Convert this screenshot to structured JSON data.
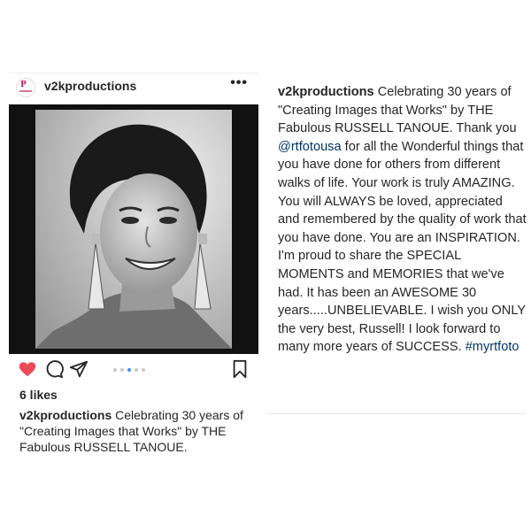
{
  "post": {
    "username": "v2kproductions",
    "avatar_letters": "P",
    "more_label": "•••",
    "likes": "6 likes",
    "caption_username": "v2kproductions",
    "caption_text": " Celebrating 30 years of \"Creating Images that Works\" by THE Fabulous RUSSELL TANOUE.",
    "carousel": {
      "count": 5,
      "active": 2
    },
    "colors": {
      "heart": "#ed4956",
      "dot_active": "#3897f0",
      "text": "#262626"
    }
  },
  "full_caption": {
    "username": "v2kproductions",
    "part1": " Celebrating 30 years of \"Creating Images that Works\" by THE Fabulous RUSSELL TANOUE. Thank you ",
    "mention": "@rtfotousa",
    "part2": " for all the Wonderful things that you have done for others from different walks of life. Your work is truly AMAZING. You will ALWAYS be loved, appreciated and remembered by the quality of work that you have done. You are an INSPIRATION.  I'm proud to share the SPECIAL MOMENTS and MEMORIES that we've had.  It has been an AWESOME 30 years.....UNBELIEVABLE.  I wish you ONLY the very best,  Russell! I look forward to many more years of SUCCESS. ",
    "hashtag": "#myrtfoto",
    "link_color": "#003569"
  }
}
